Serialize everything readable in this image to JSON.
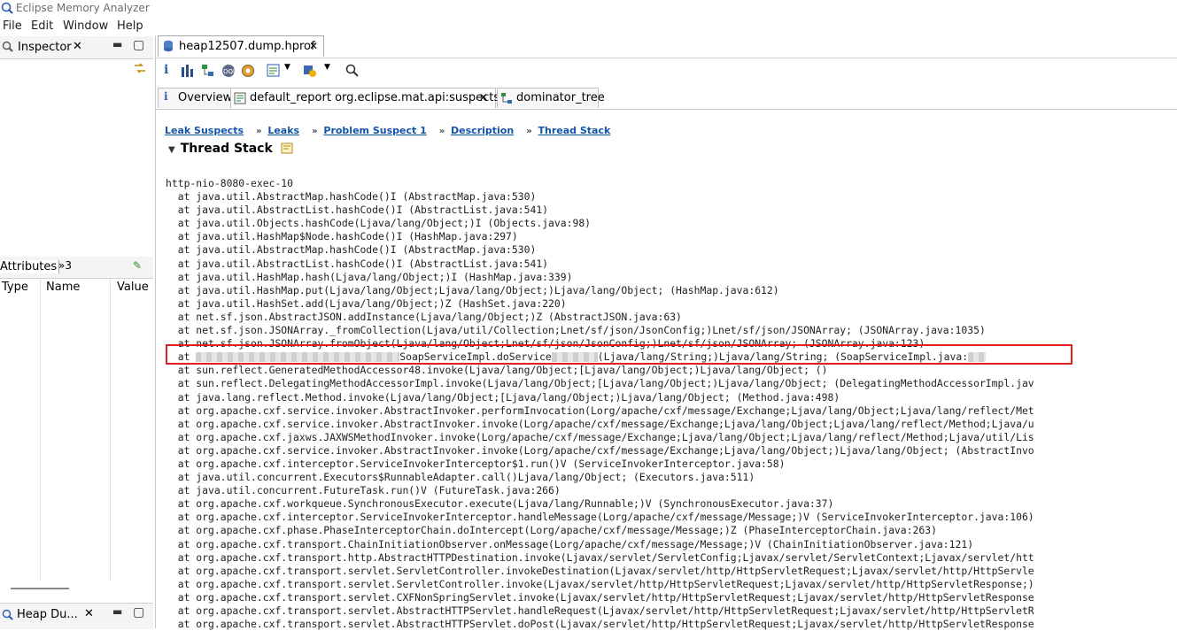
{
  "app": {
    "title": "Eclipse Memory Analyzer"
  },
  "menu": [
    "File",
    "Edit",
    "Window",
    "Help"
  ],
  "inspector": {
    "tab_label": "Inspector",
    "attributes_tab": "Attributes",
    "overflow_tab": "»3",
    "columns": [
      "Type",
      "Name",
      "Value"
    ]
  },
  "heap_dump_view": {
    "tab_label": "Heap Du..."
  },
  "editor": {
    "file_tab": "heap12507.dump.hprof",
    "subtabs": [
      "Overview",
      "default_report org.eclipse.mat.api:suspects",
      "dominator_tree"
    ]
  },
  "breadcrumb": [
    "Leak Suspects",
    "Leaks",
    "Problem Suspect 1",
    "Description",
    "Thread Stack"
  ],
  "section": {
    "title": "Thread Stack"
  },
  "stack": {
    "thread": "http-nio-8080-exec-10",
    "lines": [
      "  at java.util.AbstractMap.hashCode()I (AbstractMap.java:530)",
      "  at java.util.AbstractList.hashCode()I (AbstractList.java:541)",
      "  at java.util.Objects.hashCode(Ljava/lang/Object;)I (Objects.java:98)",
      "  at java.util.HashMap$Node.hashCode()I (HashMap.java:297)",
      "  at java.util.AbstractMap.hashCode()I (AbstractMap.java:530)",
      "  at java.util.AbstractList.hashCode()I (AbstractList.java:541)",
      "  at java.util.HashMap.hash(Ljava/lang/Object;)I (HashMap.java:339)",
      "  at java.util.HashMap.put(Ljava/lang/Object;Ljava/lang/Object;)Ljava/lang/Object; (HashMap.java:612)",
      "  at java.util.HashSet.add(Ljava/lang/Object;)Z (HashSet.java:220)",
      "  at net.sf.json.AbstractJSON.addInstance(Ljava/lang/Object;)Z (AbstractJSON.java:63)",
      "  at net.sf.json.JSONArray._fromCollection(Ljava/util/Collection;Lnet/sf/json/JsonConfig;)Lnet/sf/json/JSONArray; (JSONArray.java:1035)",
      "  at net.sf.json.JSONArray.fromObject(Ljava/lang/Object;Lnet/sf/json/JsonConfig;)Lnet/sf/json/JSONArray; (JSONArray.java:123)"
    ],
    "highlight_parts": [
      "  at",
      "SoapServiceImpl.doService",
      "(Ljava/lang/String;)Ljava/lang/String; (SoapServiceImpl.java:"
    ],
    "lines_after": [
      "  at sun.reflect.GeneratedMethodAccessor48.invoke(Ljava/lang/Object;[Ljava/lang/Object;)Ljava/lang/Object; ()",
      "  at sun.reflect.DelegatingMethodAccessorImpl.invoke(Ljava/lang/Object;[Ljava/lang/Object;)Ljava/lang/Object; (DelegatingMethodAccessorImpl.jav",
      "  at java.lang.reflect.Method.invoke(Ljava/lang/Object;[Ljava/lang/Object;)Ljava/lang/Object; (Method.java:498)",
      "  at org.apache.cxf.service.invoker.AbstractInvoker.performInvocation(Lorg/apache/cxf/message/Exchange;Ljava/lang/Object;Ljava/lang/reflect/Met",
      "  at org.apache.cxf.service.invoker.AbstractInvoker.invoke(Lorg/apache/cxf/message/Exchange;Ljava/lang/Object;Ljava/lang/reflect/Method;Ljava/u",
      "  at org.apache.cxf.jaxws.JAXWSMethodInvoker.invoke(Lorg/apache/cxf/message/Exchange;Ljava/lang/Object;Ljava/lang/reflect/Method;Ljava/util/Lis",
      "  at org.apache.cxf.service.invoker.AbstractInvoker.invoke(Lorg/apache/cxf/message/Exchange;Ljava/lang/Object;)Ljava/lang/Object; (AbstractInvo",
      "  at org.apache.cxf.interceptor.ServiceInvokerInterceptor$1.run()V (ServiceInvokerInterceptor.java:58)",
      "  at java.util.concurrent.Executors$RunnableAdapter.call()Ljava/lang/Object; (Executors.java:511)",
      "  at java.util.concurrent.FutureTask.run()V (FutureTask.java:266)",
      "  at org.apache.cxf.workqueue.SynchronousExecutor.execute(Ljava/lang/Runnable;)V (SynchronousExecutor.java:37)",
      "  at org.apache.cxf.interceptor.ServiceInvokerInterceptor.handleMessage(Lorg/apache/cxf/message/Message;)V (ServiceInvokerInterceptor.java:106)",
      "  at org.apache.cxf.phase.PhaseInterceptorChain.doIntercept(Lorg/apache/cxf/message/Message;)Z (PhaseInterceptorChain.java:263)",
      "  at org.apache.cxf.transport.ChainInitiationObserver.onMessage(Lorg/apache/cxf/message/Message;)V (ChainInitiationObserver.java:121)",
      "  at org.apache.cxf.transport.http.AbstractHTTPDestination.invoke(Ljavax/servlet/ServletConfig;Ljavax/servlet/ServletContext;Ljavax/servlet/htt",
      "  at org.apache.cxf.transport.servlet.ServletController.invokeDestination(Ljavax/servlet/http/HttpServletRequest;Ljavax/servlet/http/HttpServle",
      "  at org.apache.cxf.transport.servlet.ServletController.invoke(Ljavax/servlet/http/HttpServletRequest;Ljavax/servlet/http/HttpServletResponse;)",
      "  at org.apache.cxf.transport.servlet.CXFNonSpringServlet.invoke(Ljavax/servlet/http/HttpServletRequest;Ljavax/servlet/http/HttpServletResponse",
      "  at org.apache.cxf.transport.servlet.AbstractHTTPServlet.handleRequest(Ljavax/servlet/http/HttpServletRequest;Ljavax/servlet/http/HttpServletR",
      "  at org.apache.cxf.transport.servlet.AbstractHTTPServlet.doPost(Ljavax/servlet/http/HttpServletRequest;Ljavax/servlet/http/HttpServletResponse"
    ]
  }
}
